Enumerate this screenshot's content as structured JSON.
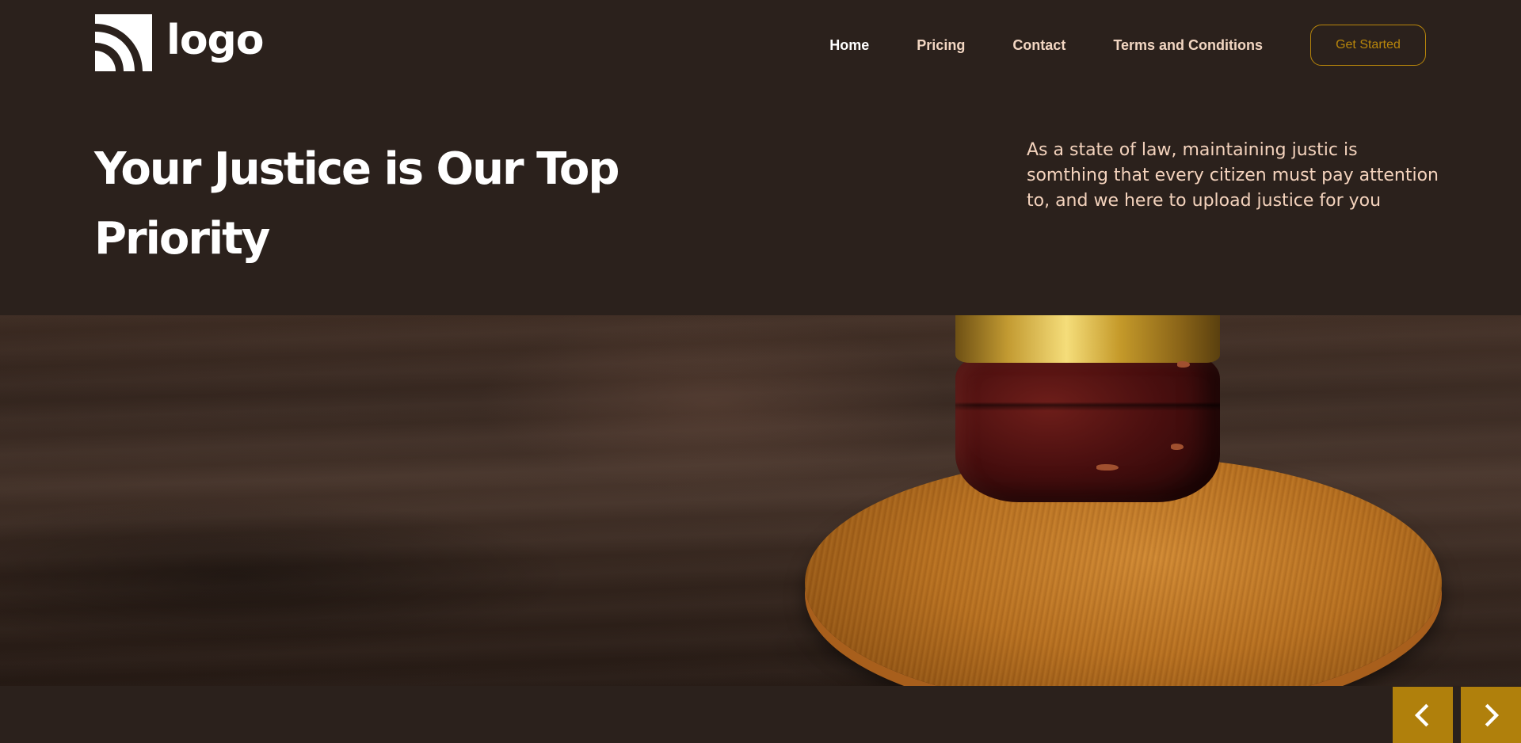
{
  "header": {
    "logo": {
      "text": "logo",
      "icon": "rss-signal-icon"
    },
    "nav": {
      "items": [
        {
          "label": "Home",
          "active": true
        },
        {
          "label": "Pricing",
          "active": false
        },
        {
          "label": "Contact",
          "active": false
        },
        {
          "label": "Terms and Conditions",
          "active": false
        }
      ],
      "cta_label": "Get Started"
    }
  },
  "hero": {
    "title": "Your Justice is Our Top Priority",
    "description": "As a state of law, maintaining justic is somthing that every citizen must pay attention to, and we here to upload justice for you",
    "image": "gavel-photo"
  },
  "slider": {
    "prev_icon": "chevron-left-icon",
    "next_icon": "chevron-right-icon"
  },
  "colors": {
    "background": "#2b211c",
    "accent": "#b0800c",
    "nav_text": "#f2d6c2",
    "description_text": "#f4d3bd"
  }
}
